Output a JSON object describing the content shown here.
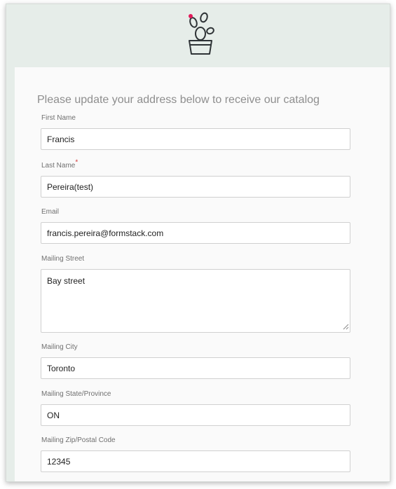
{
  "form": {
    "heading": "Please update your address below to receive our catalog",
    "required_marker": "*",
    "fields": [
      {
        "label": "First Name",
        "value": "Francis",
        "required": false
      },
      {
        "label": "Last Name",
        "value": "Pereira(test)",
        "required": true
      },
      {
        "label": "Email",
        "value": "francis.pereira@formstack.com",
        "required": false
      },
      {
        "label": "Mailing Street",
        "value": "Bay street",
        "required": false,
        "multiline": true
      },
      {
        "label": "Mailing City",
        "value": "Toronto",
        "required": false
      },
      {
        "label": "Mailing State/Province",
        "value": "ON",
        "required": false
      },
      {
        "label": "Mailing Zip/Postal Code",
        "value": "12345",
        "required": false
      }
    ]
  },
  "logo": {
    "icon": "cactus-pot-icon",
    "accent_color": "#e3195a"
  },
  "colors": {
    "page_background": "#e6ede9",
    "card_background": "#fafafa",
    "input_border": "#d0d0d0",
    "required_color": "#d33a3a",
    "heading_color": "#8e8e8e",
    "label_color": "#707070"
  }
}
